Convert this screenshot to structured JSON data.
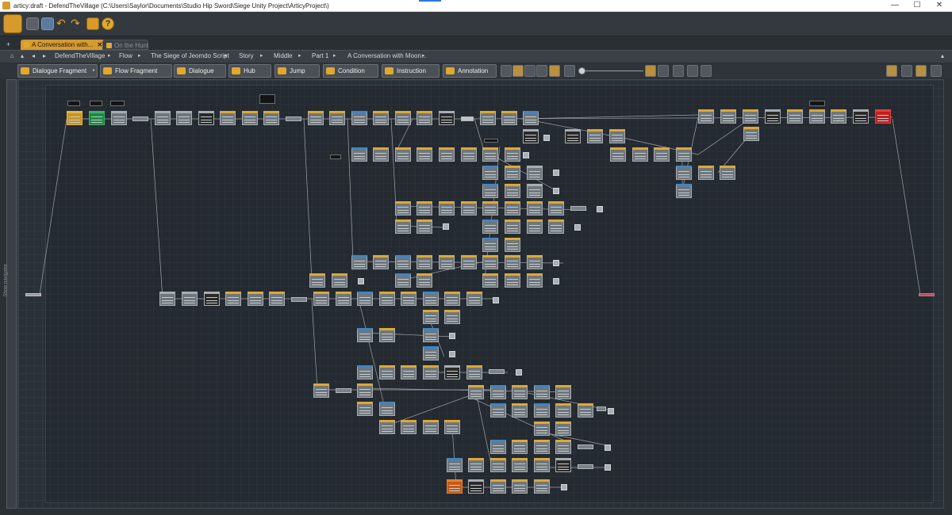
{
  "window": {
    "title": "articy:draft - DefendTheVillage (C:\\Users\\Saylor\\Documents\\Studio Hip Sword\\Siege Unity Project\\ArticyProject\\)",
    "minimize": "—",
    "maximize": "☐",
    "close": "✕"
  },
  "tabs": [
    {
      "label": "A Conversation with...",
      "active": true,
      "close": "✕"
    },
    {
      "label": "On the Hunt",
      "active": false
    }
  ],
  "breadcrumb": {
    "items": [
      "DefendTheVillage",
      "Flow",
      "The Siege of Jeomdo Script",
      "Story",
      "Middle",
      "Part 1",
      "A Conversation with Moon..."
    ],
    "separator": "▸"
  },
  "node_tools": [
    {
      "label": "Dialogue Fragment"
    },
    {
      "label": "Flow Fragment"
    },
    {
      "label": "Dialogue"
    },
    {
      "label": "Hub"
    },
    {
      "label": "Jump"
    },
    {
      "label": "Condition"
    },
    {
      "label": "Instruction"
    },
    {
      "label": "Annotation"
    }
  ],
  "side_panel": {
    "label": "Show navigator"
  },
  "colors": {
    "accent": "#d79a2b",
    "speaker_orange": "#e0a82d",
    "speaker_blue": "#3b86c8",
    "end_node": "#c01f1f",
    "start_node": "#1d8a44"
  }
}
